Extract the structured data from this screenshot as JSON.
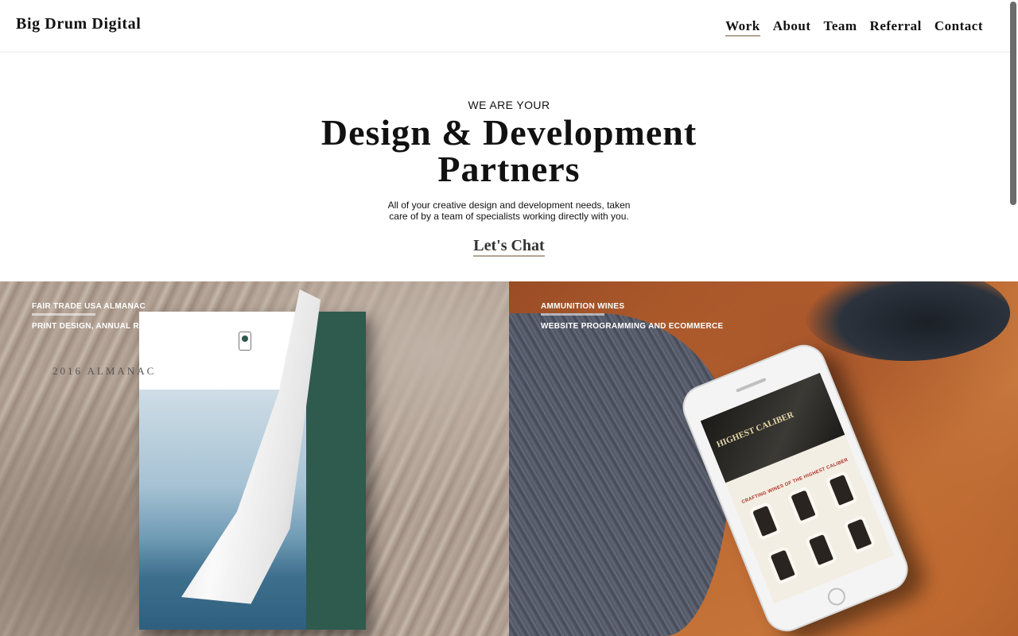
{
  "header": {
    "logo": "Big Drum Digital",
    "nav": [
      {
        "label": "Work",
        "active": true
      },
      {
        "label": "About",
        "active": false
      },
      {
        "label": "Team",
        "active": false
      },
      {
        "label": "Referral",
        "active": false
      },
      {
        "label": "Contact",
        "active": false
      }
    ]
  },
  "hero": {
    "eyebrow": "WE ARE YOUR",
    "headline": "Design & Development Partners",
    "subtext": "All of your creative design and development needs, taken care of by a team of specialists working directly with you.",
    "cta": "Let's Chat"
  },
  "tiles": [
    {
      "title": "FAIR TRADE USA ALMANAC",
      "subtitle": "PRINT DESIGN, ANNUAL REPORT",
      "book_title": "2016 ALMANAC"
    },
    {
      "title": "AMMUNITION WINES",
      "subtitle": "WEBSITE PROGRAMMING AND ECOMMERCE",
      "screen_heading": "HIGHEST CALIBER",
      "screen_tagline": "CRAFTING WINES OF THE HIGHEST CALIBER"
    }
  ],
  "colors": {
    "accent_underline": "#b3a493",
    "text": "#111111",
    "almanac_cover": "#2f5a4e",
    "leather": "#b8642f"
  },
  "icons": [
    "fair-trade-logo-icon",
    "scrollbar-thumb"
  ]
}
